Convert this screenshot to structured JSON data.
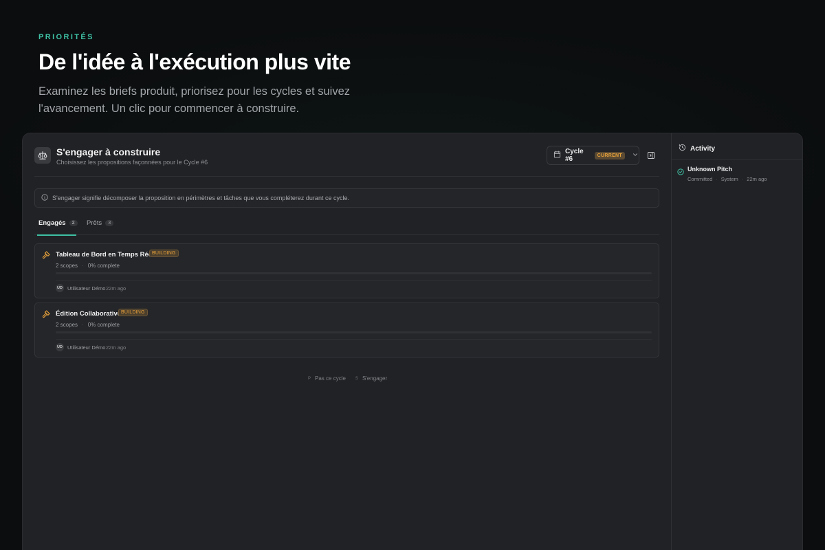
{
  "hero": {
    "eyebrow": "PRIORITÉS",
    "title": "De l'idée à l'exécution plus vite",
    "subtitle": "Examinez les briefs produit, priorisez pour les cycles et suivez l'avancement. Un clic pour commencer à construire."
  },
  "header": {
    "icon": "scale-icon",
    "title": "S'engager à construire",
    "subtitle": "Choisissez les propositions façonnées pour le Cycle #6"
  },
  "cycle": {
    "icon": "calendar-icon",
    "label": "Cycle #6",
    "badge": "CURRENT",
    "chevron": "chevron-down-icon"
  },
  "info": {
    "icon": "info-icon",
    "text": "S'engager signifie décomposer la proposition en périmètres et tâches que vous compléterez durant ce cycle."
  },
  "tabs": [
    {
      "label": "Engagés",
      "count": "2"
    },
    {
      "label": "Prêts",
      "count": "3"
    }
  ],
  "cards": [
    {
      "icon": "hammer-icon",
      "title": "Tableau de Bord en Temps Réel",
      "badge": "BUILDING",
      "scopes": "2 scopes",
      "progress_text": "0% complete",
      "progress": 0,
      "avatar": "UD",
      "user": "Utilisateur Démo",
      "time": "22m ago"
    },
    {
      "icon": "hammer-icon",
      "title": "Édition Collaborative",
      "badge": "BUILDING",
      "scopes": "2 scopes",
      "progress_text": "0% complete",
      "progress": 0,
      "avatar": "UD",
      "user": "Utilisateur Démo",
      "time": "22m ago"
    }
  ],
  "actions": {
    "skip_key": "P",
    "skip": "Pas ce cycle",
    "commit_key": "S",
    "commit": "S'engager"
  },
  "activity": {
    "icon": "history-icon",
    "title": "Activity",
    "items": [
      {
        "icon": "check-circle-icon",
        "title": "Unknown Pitch",
        "status": "Committed",
        "actor": "System",
        "time": "22m ago"
      }
    ]
  },
  "colors": {
    "accent": "#3fc1a5",
    "warning": "#e8a23a",
    "background": "#0b0d0e",
    "panel": "#212225"
  }
}
